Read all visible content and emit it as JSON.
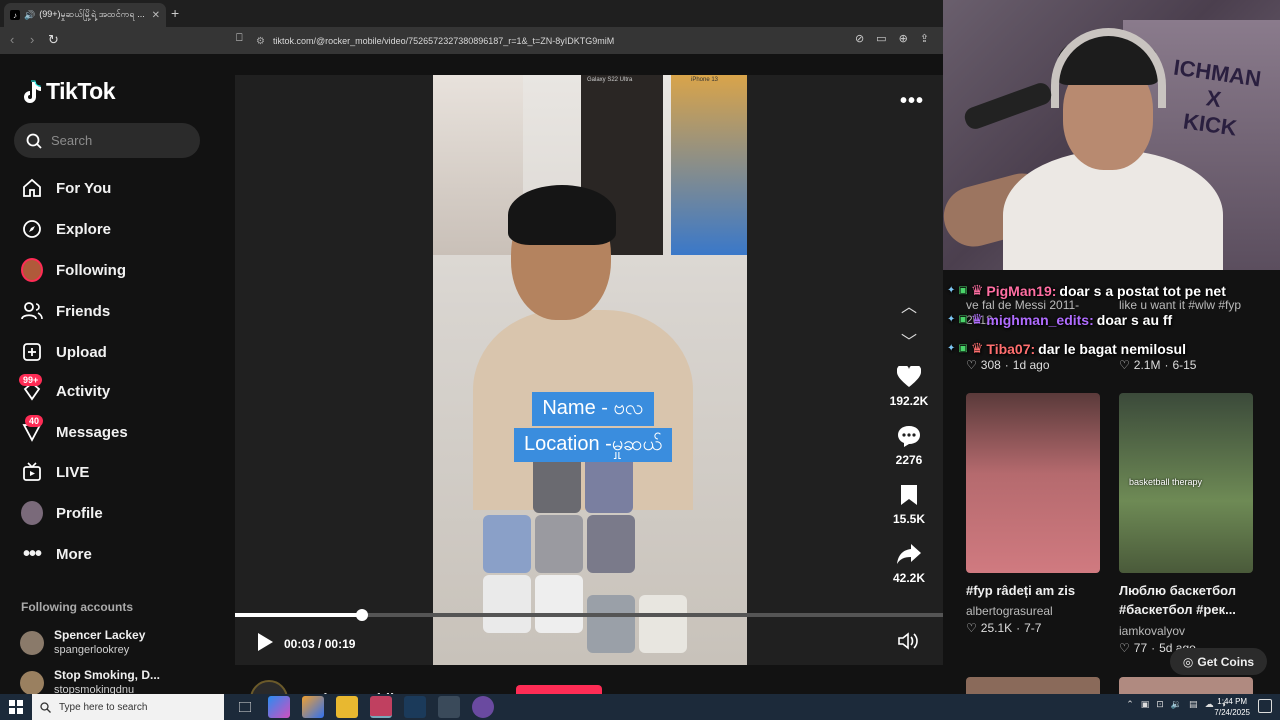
{
  "browser": {
    "tab_title": "(99+)မှုဆယ်မြို့ရဲ့ အထင်ကရ ...",
    "url": "tiktok.com/@rocker_mobile/video/7526572327380896187_r=1&_t=ZN-8yIDKTG9miM"
  },
  "sidebar": {
    "logo": "TikTok",
    "search_placeholder": "Search",
    "items": [
      {
        "label": "For You"
      },
      {
        "label": "Explore"
      },
      {
        "label": "Following"
      },
      {
        "label": "Friends"
      },
      {
        "label": "Upload"
      },
      {
        "label": "Activity",
        "badge": "99+"
      },
      {
        "label": "Messages",
        "badge": "40"
      },
      {
        "label": "LIVE"
      },
      {
        "label": "Profile"
      },
      {
        "label": "More"
      }
    ],
    "following_heading": "Following accounts",
    "accounts": [
      {
        "name": "Spencer Lackey",
        "handle": "spangerlookrey"
      },
      {
        "name": "Stop Smoking, D...",
        "handle": "stopsmokingdnu"
      }
    ]
  },
  "video": {
    "caption_line1": "Name - ဗလ",
    "caption_line2": "Location -မှုဆယ်",
    "poster_label": "Galaxy S22 Ultra",
    "poster_label2": "iPhone 13",
    "likes": "192.2K",
    "comments": "2276",
    "saves": "15.5K",
    "shares": "42.2K",
    "time_current": "00:03",
    "time_total": "00:19",
    "time_sep": " / ",
    "progress": 0.18,
    "author": "rocker_mobile"
  },
  "chat": [
    {
      "user": "PigMan19:",
      "msg": "doar s a postat tot pe net"
    },
    {
      "user": "mighman_edits:",
      "msg": "doar s au ff"
    },
    {
      "user": "Tiba07:",
      "msg": "dar le bagat nemilosul"
    }
  ],
  "grid": {
    "behind1": "ve fal de Messi 2011-2012...",
    "behind2": "like u want it #wlw #fyp",
    "top_stats": [
      {
        "likes": "308",
        "age": "1d ago"
      },
      {
        "likes": "2.1M",
        "age": "6-15"
      }
    ],
    "cards": [
      {
        "title": "#fyp râdeți am zis",
        "user": "albertograsureal",
        "likes": "25.1K",
        "age": "7-7",
        "overlay": ""
      },
      {
        "title": "Люблю баскетбол #баскетбол #рек...",
        "user": "iamkovalyov",
        "likes": "77",
        "age": "5d ago",
        "overlay": "basketball therapy"
      }
    ],
    "coins_label": "Get Coins"
  },
  "taskbar": {
    "search_placeholder": "Type here to search",
    "time": "1:44 PM",
    "date": "7/24/2025"
  }
}
